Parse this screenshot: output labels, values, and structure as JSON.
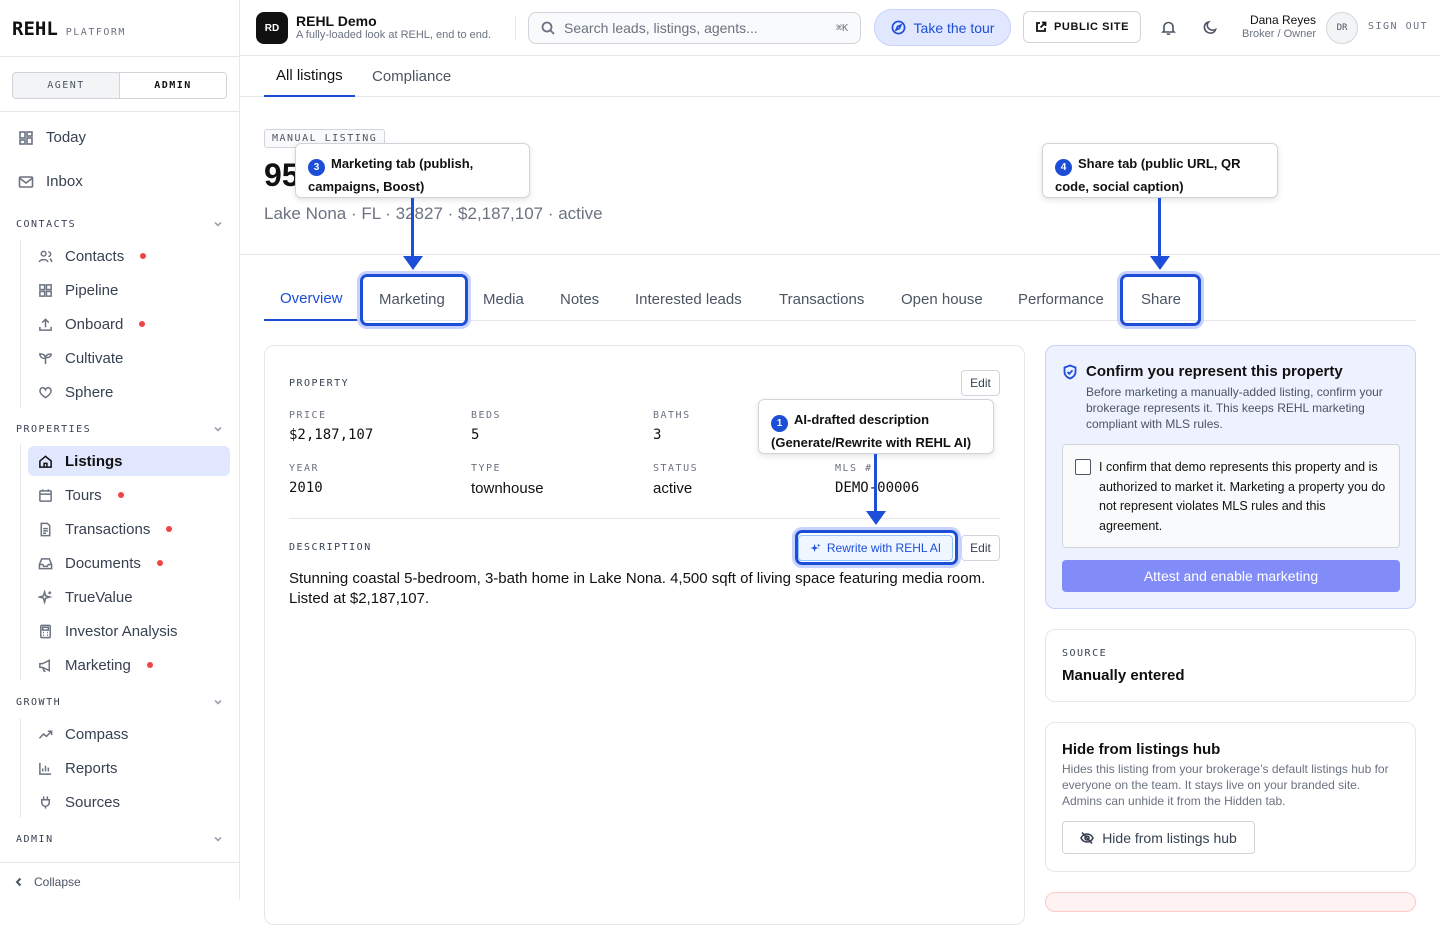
{
  "brand": {
    "name": "REHL",
    "subtitle": "PLATFORM"
  },
  "role_toggle": {
    "options": [
      "AGENT",
      "ADMIN"
    ],
    "active": "ADMIN"
  },
  "nav": {
    "top_items": [
      {
        "label": "Today",
        "icon": "dashboard-icon"
      },
      {
        "label": "Inbox",
        "icon": "mail-icon"
      }
    ],
    "sections": [
      {
        "title": "CONTACTS",
        "items": [
          {
            "label": "Contacts",
            "icon": "users-icon",
            "dot": true
          },
          {
            "label": "Pipeline",
            "icon": "grid-icon",
            "dot": false
          },
          {
            "label": "Onboard",
            "icon": "upload-icon",
            "dot": true
          },
          {
            "label": "Cultivate",
            "icon": "sprout-icon",
            "dot": false
          },
          {
            "label": "Sphere",
            "icon": "heart-icon",
            "dot": false
          }
        ]
      },
      {
        "title": "PROPERTIES",
        "items": [
          {
            "label": "Listings",
            "icon": "home-icon",
            "dot": false,
            "active": true
          },
          {
            "label": "Tours",
            "icon": "calendar-icon",
            "dot": true
          },
          {
            "label": "Transactions",
            "icon": "file-icon",
            "dot": true
          },
          {
            "label": "Documents",
            "icon": "inbox-icon",
            "dot": true
          },
          {
            "label": "TrueValue",
            "icon": "sparkle-icon",
            "dot": false
          },
          {
            "label": "Investor Analysis",
            "icon": "calculator-icon",
            "dot": false
          },
          {
            "label": "Marketing",
            "icon": "megaphone-icon",
            "dot": true
          }
        ]
      },
      {
        "title": "GROWTH",
        "items": [
          {
            "label": "Compass",
            "icon": "trend-icon",
            "dot": false
          },
          {
            "label": "Reports",
            "icon": "bar-chart-icon",
            "dot": false
          },
          {
            "label": "Sources",
            "icon": "plug-icon",
            "dot": false
          }
        ]
      },
      {
        "title": "ADMIN",
        "items": []
      }
    ],
    "collapse_label": "Collapse"
  },
  "header": {
    "org_badge": "RD",
    "org_name": "REHL Demo",
    "org_tagline": "A fully-loaded look at REHL, end to end.",
    "search_placeholder": "Search leads, listings, agents...",
    "search_shortcut": "⌘K",
    "tour_label": "Take the tour",
    "public_site_label": "PUBLIC SITE",
    "user_name": "Dana Reyes",
    "user_role": "Broker / Owner",
    "user_initials": "DR",
    "signout_label": "SIGN OUT"
  },
  "subtabs": [
    "All listings",
    "Compliance"
  ],
  "hero": {
    "badge": "MANUAL LISTING",
    "title_visible": "95",
    "meta": "Lake Nona · FL · 32827 · $2,187,107 · active"
  },
  "listing_tabs": [
    "Overview",
    "Marketing",
    "Media",
    "Notes",
    "Interested leads",
    "Transactions",
    "Open house",
    "Performance",
    "Share"
  ],
  "property": {
    "section_label": "PROPERTY",
    "edit_label": "Edit",
    "fields": [
      {
        "label": "PRICE",
        "value": "$2,187,107",
        "mono": true
      },
      {
        "label": "BEDS",
        "value": "5",
        "mono": true
      },
      {
        "label": "BATHS",
        "value": "3",
        "mono": true
      },
      {
        "label": "YEAR",
        "value": "2010",
        "mono": true
      },
      {
        "label": "TYPE",
        "value": "townhouse",
        "mono": false
      },
      {
        "label": "STATUS",
        "value": "active",
        "mono": false
      },
      {
        "label": "MLS #",
        "value": "DEMO-00006",
        "mono": true
      }
    ],
    "description_label": "DESCRIPTION",
    "ai_button_label": "Rewrite with REHL AI",
    "description": "Stunning coastal 5-bedroom, 3-bath home in Lake Nona. 4,500 sqft of living space featuring media room. Listed at $2,187,107."
  },
  "confirm": {
    "title": "Confirm you represent this property",
    "description": "Before marketing a manually-added listing, confirm your brokerage represents it. This keeps REHL marketing compliant with MLS rules.",
    "checkbox_text": "I confirm that demo represents this property and is authorized to market it. Marketing a property you do not represent violates MLS rules and this agreement.",
    "button_label": "Attest and enable marketing"
  },
  "source": {
    "label": "SOURCE",
    "value": "Manually entered"
  },
  "hide": {
    "title": "Hide from listings hub",
    "description": "Hides this listing from your brokerage’s default listings hub for everyone on the team. It stays live on your branded site. Admins can unhide it from the Hidden tab.",
    "button_label": "Hide from listings hub"
  },
  "callouts": [
    {
      "num": "3",
      "text": "Marketing tab (publish, campaigns, Boost)"
    },
    {
      "num": "4",
      "text": "Share tab (public URL, QR code, social caption)"
    },
    {
      "num": "1",
      "text": "AI-drafted description (Generate/Rewrite with REHL AI)"
    }
  ],
  "colors": {
    "accent": "#1d4ed8",
    "accent_soft": "#e0e7ff",
    "alert_dot": "#ef4444",
    "attest_button": "#818cf8"
  }
}
